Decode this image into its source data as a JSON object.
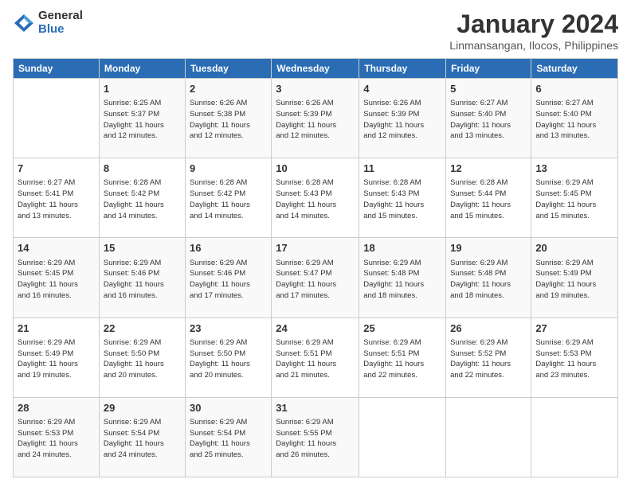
{
  "logo": {
    "general": "General",
    "blue": "Blue"
  },
  "title": "January 2024",
  "subtitle": "Linmansangan, Ilocos, Philippines",
  "days": [
    "Sunday",
    "Monday",
    "Tuesday",
    "Wednesday",
    "Thursday",
    "Friday",
    "Saturday"
  ],
  "weeks": [
    [
      {
        "date": "",
        "info": ""
      },
      {
        "date": "1",
        "info": "Sunrise: 6:25 AM\nSunset: 5:37 PM\nDaylight: 11 hours\nand 12 minutes."
      },
      {
        "date": "2",
        "info": "Sunrise: 6:26 AM\nSunset: 5:38 PM\nDaylight: 11 hours\nand 12 minutes."
      },
      {
        "date": "3",
        "info": "Sunrise: 6:26 AM\nSunset: 5:39 PM\nDaylight: 11 hours\nand 12 minutes."
      },
      {
        "date": "4",
        "info": "Sunrise: 6:26 AM\nSunset: 5:39 PM\nDaylight: 11 hours\nand 12 minutes."
      },
      {
        "date": "5",
        "info": "Sunrise: 6:27 AM\nSunset: 5:40 PM\nDaylight: 11 hours\nand 13 minutes."
      },
      {
        "date": "6",
        "info": "Sunrise: 6:27 AM\nSunset: 5:40 PM\nDaylight: 11 hours\nand 13 minutes."
      }
    ],
    [
      {
        "date": "7",
        "info": "Sunrise: 6:27 AM\nSunset: 5:41 PM\nDaylight: 11 hours\nand 13 minutes."
      },
      {
        "date": "8",
        "info": "Sunrise: 6:28 AM\nSunset: 5:42 PM\nDaylight: 11 hours\nand 14 minutes."
      },
      {
        "date": "9",
        "info": "Sunrise: 6:28 AM\nSunset: 5:42 PM\nDaylight: 11 hours\nand 14 minutes."
      },
      {
        "date": "10",
        "info": "Sunrise: 6:28 AM\nSunset: 5:43 PM\nDaylight: 11 hours\nand 14 minutes."
      },
      {
        "date": "11",
        "info": "Sunrise: 6:28 AM\nSunset: 5:43 PM\nDaylight: 11 hours\nand 15 minutes."
      },
      {
        "date": "12",
        "info": "Sunrise: 6:28 AM\nSunset: 5:44 PM\nDaylight: 11 hours\nand 15 minutes."
      },
      {
        "date": "13",
        "info": "Sunrise: 6:29 AM\nSunset: 5:45 PM\nDaylight: 11 hours\nand 15 minutes."
      }
    ],
    [
      {
        "date": "14",
        "info": "Sunrise: 6:29 AM\nSunset: 5:45 PM\nDaylight: 11 hours\nand 16 minutes."
      },
      {
        "date": "15",
        "info": "Sunrise: 6:29 AM\nSunset: 5:46 PM\nDaylight: 11 hours\nand 16 minutes."
      },
      {
        "date": "16",
        "info": "Sunrise: 6:29 AM\nSunset: 5:46 PM\nDaylight: 11 hours\nand 17 minutes."
      },
      {
        "date": "17",
        "info": "Sunrise: 6:29 AM\nSunset: 5:47 PM\nDaylight: 11 hours\nand 17 minutes."
      },
      {
        "date": "18",
        "info": "Sunrise: 6:29 AM\nSunset: 5:48 PM\nDaylight: 11 hours\nand 18 minutes."
      },
      {
        "date": "19",
        "info": "Sunrise: 6:29 AM\nSunset: 5:48 PM\nDaylight: 11 hours\nand 18 minutes."
      },
      {
        "date": "20",
        "info": "Sunrise: 6:29 AM\nSunset: 5:49 PM\nDaylight: 11 hours\nand 19 minutes."
      }
    ],
    [
      {
        "date": "21",
        "info": "Sunrise: 6:29 AM\nSunset: 5:49 PM\nDaylight: 11 hours\nand 19 minutes."
      },
      {
        "date": "22",
        "info": "Sunrise: 6:29 AM\nSunset: 5:50 PM\nDaylight: 11 hours\nand 20 minutes."
      },
      {
        "date": "23",
        "info": "Sunrise: 6:29 AM\nSunset: 5:50 PM\nDaylight: 11 hours\nand 20 minutes."
      },
      {
        "date": "24",
        "info": "Sunrise: 6:29 AM\nSunset: 5:51 PM\nDaylight: 11 hours\nand 21 minutes."
      },
      {
        "date": "25",
        "info": "Sunrise: 6:29 AM\nSunset: 5:51 PM\nDaylight: 11 hours\nand 22 minutes."
      },
      {
        "date": "26",
        "info": "Sunrise: 6:29 AM\nSunset: 5:52 PM\nDaylight: 11 hours\nand 22 minutes."
      },
      {
        "date": "27",
        "info": "Sunrise: 6:29 AM\nSunset: 5:53 PM\nDaylight: 11 hours\nand 23 minutes."
      }
    ],
    [
      {
        "date": "28",
        "info": "Sunrise: 6:29 AM\nSunset: 5:53 PM\nDaylight: 11 hours\nand 24 minutes."
      },
      {
        "date": "29",
        "info": "Sunrise: 6:29 AM\nSunset: 5:54 PM\nDaylight: 11 hours\nand 24 minutes."
      },
      {
        "date": "30",
        "info": "Sunrise: 6:29 AM\nSunset: 5:54 PM\nDaylight: 11 hours\nand 25 minutes."
      },
      {
        "date": "31",
        "info": "Sunrise: 6:29 AM\nSunset: 5:55 PM\nDaylight: 11 hours\nand 26 minutes."
      },
      {
        "date": "",
        "info": ""
      },
      {
        "date": "",
        "info": ""
      },
      {
        "date": "",
        "info": ""
      }
    ]
  ]
}
